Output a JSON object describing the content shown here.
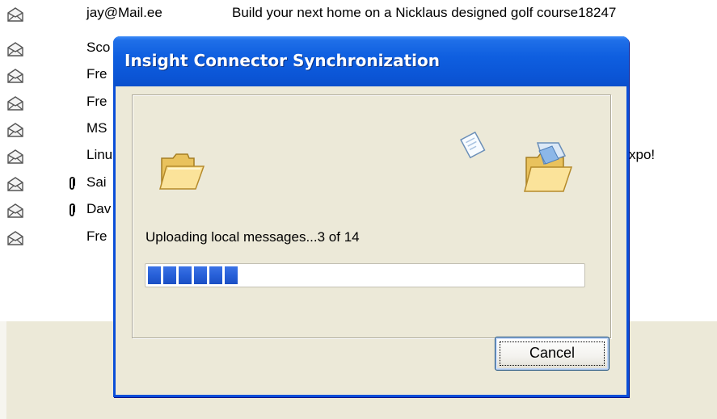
{
  "mail_list": {
    "rows": [
      {
        "from": "jay@Mail.ee",
        "subject": "Build your next home on a Nicklaus designed golf course18247",
        "attachment": false
      },
      {
        "from": "Sco",
        "subject": "",
        "attachment": false
      },
      {
        "from": "Fre",
        "subject": "",
        "attachment": false
      },
      {
        "from": "Fre",
        "subject": "",
        "attachment": false
      },
      {
        "from": "MS",
        "subject": "",
        "attachment": false
      },
      {
        "from": "Linu",
        "subject": "xpo!",
        "attachment": false
      },
      {
        "from": "Sai",
        "subject": "",
        "attachment": true
      },
      {
        "from": "Dav",
        "subject": "",
        "attachment": true
      },
      {
        "from": "Fre",
        "subject": "",
        "attachment": false
      }
    ],
    "row_icon": "envelope-icon",
    "attachment_icon": "paperclip-icon"
  },
  "dialog": {
    "title": "Insight Connector Synchronization",
    "status": "Uploading local messages...3 of 14",
    "progress": 0.214,
    "cancel_label": "Cancel",
    "icons": [
      "folder-open-icon",
      "document-icon",
      "mail-folder-icon"
    ],
    "colors": {
      "titlebar": "#0b55d6",
      "progress": "#2760d8",
      "face": "#ece9d8"
    }
  }
}
